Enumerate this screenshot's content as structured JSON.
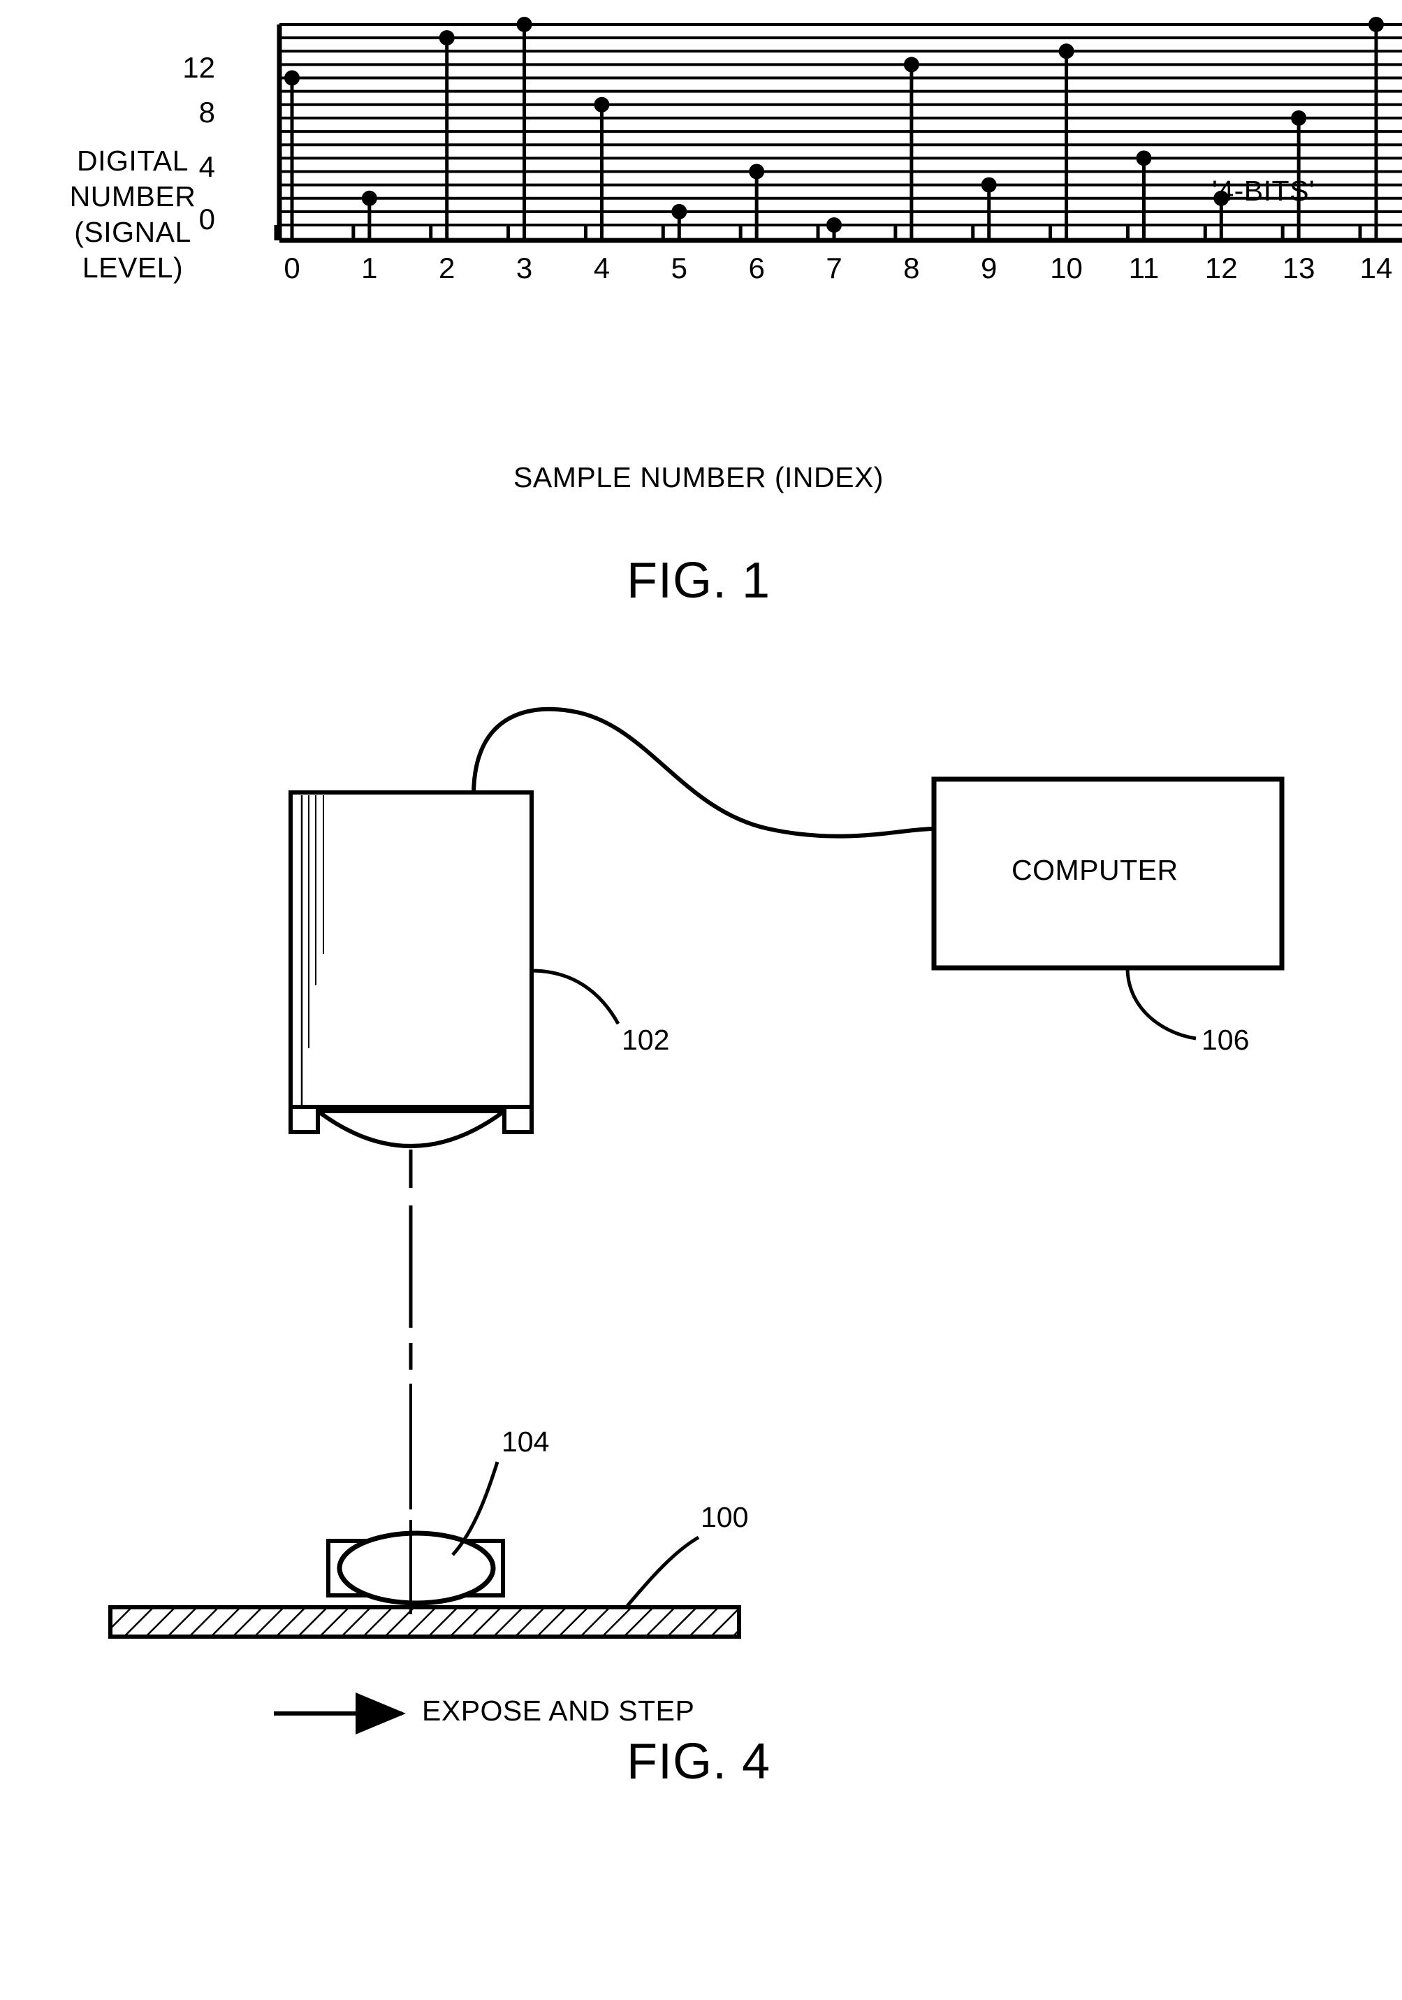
{
  "figures": [
    {
      "id": "fig1",
      "caption": "FIG. 1",
      "annotation": "'4-BITS'"
    },
    {
      "id": "fig4",
      "caption": "FIG. 4"
    }
  ],
  "chart_data": {
    "type": "scatter",
    "title": "",
    "xlabel": "SAMPLE NUMBER (INDEX)",
    "ylabel": "DIGITAL NUMBER (SIGNAL LEVEL)",
    "annotation": "'4-BITS'",
    "x": [
      0,
      1,
      2,
      3,
      4,
      5,
      6,
      7,
      8,
      9,
      10,
      11,
      12,
      13,
      14
    ],
    "values": [
      11,
      2,
      14,
      15,
      9,
      1,
      4,
      0,
      12,
      3,
      13,
      5,
      2,
      8,
      15
    ],
    "categories": [
      "0",
      "1",
      "2",
      "3",
      "4",
      "5",
      "6",
      "7",
      "8",
      "9",
      "10",
      "11",
      "12",
      "13",
      "14"
    ],
    "xlim": [
      0,
      14
    ],
    "ylim": [
      0,
      15
    ],
    "ytick_values": [
      0,
      4,
      8,
      12
    ],
    "ytick_labels": [
      "0",
      "4",
      "8",
      "12"
    ],
    "xtick_labels": [
      "0",
      "1",
      "2",
      "3",
      "4",
      "5",
      "6",
      "7",
      "8",
      "9",
      "10",
      "11",
      "12",
      "13",
      "14"
    ],
    "grid": "horizontal gridlines at every integer 0-15; vertical stems at each sample",
    "legend": "none",
    "marker": "filled circle with vertical stem to baseline"
  },
  "fig1": {
    "ylabel": "DIGITAL\nNUMBER\n(SIGNAL\nLEVEL)",
    "xlabel": "SAMPLE NUMBER (INDEX)",
    "bits_label": "'4-BITS'",
    "caption": "FIG. 1"
  },
  "fig4": {
    "caption": "FIG. 4",
    "computer_box_label": "COMPUTER",
    "motion_label": "EXPOSE AND STEP",
    "references": [
      {
        "number": "100",
        "target": "substrate"
      },
      {
        "number": "102",
        "target": "camera-head"
      },
      {
        "number": "104",
        "target": "lens"
      },
      {
        "number": "106",
        "target": "computer"
      }
    ],
    "ref_100": "100",
    "ref_102": "102",
    "ref_104": "104",
    "ref_106": "106"
  }
}
